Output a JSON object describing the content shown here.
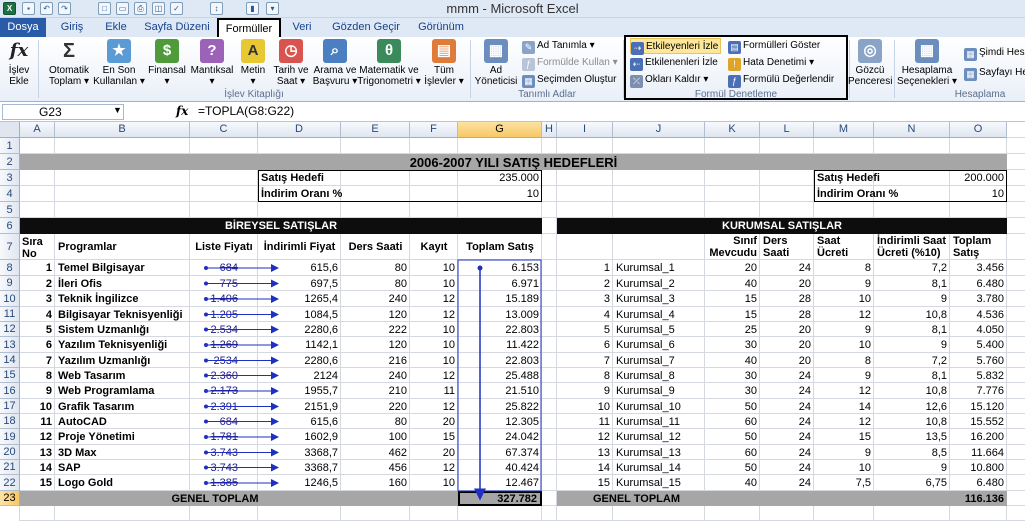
{
  "window": {
    "title": "mmm  -  Microsoft Excel",
    "app_icon": "excel-icon"
  },
  "quick_access": [
    "save-icon",
    "undo-icon",
    "redo-icon",
    "new-icon",
    "open-icon",
    "print-icon",
    "preview-icon",
    "spell-icon",
    "sort-icon",
    "chart-icon",
    "dropdown-icon"
  ],
  "tabs": [
    {
      "label": "Dosya",
      "state": "file"
    },
    {
      "label": "Giriş",
      "state": ""
    },
    {
      "label": "Ekle",
      "state": ""
    },
    {
      "label": "Sayfa Düzeni",
      "state": ""
    },
    {
      "label": "Formüller",
      "state": "active"
    },
    {
      "label": "Veri",
      "state": ""
    },
    {
      "label": "Gözden Geçir",
      "state": ""
    },
    {
      "label": "Görünüm",
      "state": ""
    }
  ],
  "ribbon": {
    "insert_function": {
      "line1": "İşlev",
      "line2": "Ekle"
    },
    "autosum": {
      "line1": "Otomatik",
      "line2": "Toplam ▾"
    },
    "recent": {
      "line1": "En Son",
      "line2": "Kullanılan ▾"
    },
    "financial": {
      "line1": "Finansal",
      "line2": "▾"
    },
    "logical": {
      "line1": "Mantıksal",
      "line2": "▾"
    },
    "text": {
      "line1": "Metin",
      "line2": "▾"
    },
    "datetime": {
      "line1": "Tarih ve",
      "line2": "Saat ▾"
    },
    "lookup": {
      "line1": "Arama ve",
      "line2": "Başvuru ▾"
    },
    "math": {
      "line1": "Matematik ve",
      "line2": "Trigonometri ▾"
    },
    "all_functions": {
      "line1": "Tüm",
      "line2": "İşlevler ▾"
    },
    "library_label": "İşlev Kitaplığı",
    "name_manager": {
      "line1": "Ad",
      "line2": "Yöneticisi"
    },
    "define_name": "Ad Tanımla ▾",
    "use_in_formula": "Formülde Kullan ▾",
    "create_from_selection": "Seçimden Oluştur",
    "names_label": "Tanımlı Adlar",
    "trace_precedents": "Etkileyenleri İzle",
    "trace_dependents": "Etkilenenleri İzle",
    "remove_arrows": "Okları Kaldır ▾",
    "show_formulas": "Formülleri Göster",
    "error_checking": "Hata Denetimi ▾",
    "evaluate_formula": "Formülü Değerlendir",
    "audit_label": "Formül Denetleme",
    "watch_window": {
      "line1": "Gözcü",
      "line2": "Penceresi"
    },
    "calc_options": {
      "line1": "Hesaplama",
      "line2": "Seçenekleri ▾"
    },
    "calc_now": "Şimdi Hesa",
    "calc_sheet": "Sayfayı He",
    "calc_label": "Hesaplama"
  },
  "formula_bar": {
    "name_box": "G23",
    "fx": "fx",
    "formula": "=TOPLA(G8:G22)"
  },
  "columns": [
    "A",
    "B",
    "C",
    "D",
    "E",
    "F",
    "G",
    "H",
    "I",
    "J",
    "K",
    "L",
    "M",
    "N",
    "O"
  ],
  "rows": [
    "1",
    "2",
    "3",
    "4",
    "5",
    "6",
    "7",
    "8",
    "9",
    "10",
    "11",
    "12",
    "13",
    "14",
    "15",
    "16",
    "17",
    "18",
    "19",
    "20",
    "21",
    "22",
    "23"
  ],
  "sheet": {
    "main_title": "2006-2007 YILI SATIŞ HEDEFLERİ",
    "left_target_label": "Satış Hedefi",
    "left_target_value": "235.000",
    "left_discount_label": "İndirim Oranı %",
    "left_discount_value": "10",
    "right_target_label": "Satış Hedefi",
    "right_target_value": "200.000",
    "right_discount_label": "İndirim Oranı %",
    "right_discount_value": "10",
    "left_section": "BİREYSEL SATIŞLAR",
    "right_section": "KURUMSAL SATIŞLAR",
    "left_headers": {
      "no": "Sıra No",
      "program": "Programlar",
      "list_price": "Liste Fiyatı",
      "disc_price": "İndirimli Fiyat",
      "hours": "Ders Saati",
      "reg": "Kayıt",
      "total": "Toplam Satış"
    },
    "right_headers": {
      "existing": "Sınıf Mevcudu",
      "hours": "Ders Saati",
      "fee": "Saat Ücreti",
      "disc_fee": "İndirimli Saat Ücreti (%10)",
      "total": "Toplam Satış"
    },
    "left_rows": [
      {
        "no": "1",
        "program": "Temel Bilgisayar",
        "list": "684",
        "disc": "615,6",
        "hours": "80",
        "reg": "10",
        "total": "6.153"
      },
      {
        "no": "2",
        "program": "İleri Ofis",
        "list": "775",
        "disc": "697,5",
        "hours": "80",
        "reg": "10",
        "total": "6.971"
      },
      {
        "no": "3",
        "program": "Teknik İngilizce",
        "list": "1.406",
        "disc": "1265,4",
        "hours": "240",
        "reg": "12",
        "total": "15.189"
      },
      {
        "no": "4",
        "program": "Bilgisayar Teknisyenliği",
        "list": "1.205",
        "disc": "1084,5",
        "hours": "120",
        "reg": "12",
        "total": "13.009"
      },
      {
        "no": "5",
        "program": "Sistem Uzmanlığı",
        "list": "2.534",
        "disc": "2280,6",
        "hours": "222",
        "reg": "10",
        "total": "22.803"
      },
      {
        "no": "6",
        "program": "Yazılım Teknisyenliği",
        "list": "1.269",
        "disc": "1142,1",
        "hours": "120",
        "reg": "10",
        "total": "11.422"
      },
      {
        "no": "7",
        "program": "Yazılım Uzmanlığı",
        "list": "2534",
        "disc": "2280,6",
        "hours": "216",
        "reg": "10",
        "total": "22.803"
      },
      {
        "no": "8",
        "program": "Web Tasarım",
        "list": "2.360",
        "disc": "2124",
        "hours": "240",
        "reg": "12",
        "total": "25.488"
      },
      {
        "no": "9",
        "program": "Web Programlama",
        "list": "2.173",
        "disc": "1955,7",
        "hours": "210",
        "reg": "11",
        "total": "21.510"
      },
      {
        "no": "10",
        "program": "Grafik Tasarım",
        "list": "2.391",
        "disc": "2151,9",
        "hours": "220",
        "reg": "12",
        "total": "25.822"
      },
      {
        "no": "11",
        "program": "AutoCAD",
        "list": "684",
        "disc": "615,6",
        "hours": "80",
        "reg": "20",
        "total": "12.305"
      },
      {
        "no": "12",
        "program": "Proje Yönetimi",
        "list": "1.781",
        "disc": "1602,9",
        "hours": "100",
        "reg": "15",
        "total": "24.042"
      },
      {
        "no": "13",
        "program": "3D Max",
        "list": "3.743",
        "disc": "3368,7",
        "hours": "462",
        "reg": "20",
        "total": "67.374"
      },
      {
        "no": "14",
        "program": "SAP",
        "list": "3.743",
        "disc": "3368,7",
        "hours": "456",
        "reg": "12",
        "total": "40.424"
      },
      {
        "no": "15",
        "program": "Logo Gold",
        "list": "1.385",
        "disc": "1246,5",
        "hours": "160",
        "reg": "10",
        "total": "12.467"
      }
    ],
    "right_rows": [
      {
        "no": "1",
        "name": "Kurumsal_1",
        "existing": "20",
        "hours": "24",
        "fee": "8",
        "disc": "7,2",
        "total": "3.456"
      },
      {
        "no": "2",
        "name": "Kurumsal_2",
        "existing": "40",
        "hours": "20",
        "fee": "9",
        "disc": "8,1",
        "total": "6.480"
      },
      {
        "no": "3",
        "name": "Kurumsal_3",
        "existing": "15",
        "hours": "28",
        "fee": "10",
        "disc": "9",
        "total": "3.780"
      },
      {
        "no": "4",
        "name": "Kurumsal_4",
        "existing": "15",
        "hours": "28",
        "fee": "12",
        "disc": "10,8",
        "total": "4.536"
      },
      {
        "no": "5",
        "name": "Kurumsal_5",
        "existing": "25",
        "hours": "20",
        "fee": "9",
        "disc": "8,1",
        "total": "4.050"
      },
      {
        "no": "6",
        "name": "Kurumsal_6",
        "existing": "30",
        "hours": "20",
        "fee": "10",
        "disc": "9",
        "total": "5.400"
      },
      {
        "no": "7",
        "name": "Kurumsal_7",
        "existing": "40",
        "hours": "20",
        "fee": "8",
        "disc": "7,2",
        "total": "5.760"
      },
      {
        "no": "8",
        "name": "Kurumsal_8",
        "existing": "30",
        "hours": "24",
        "fee": "9",
        "disc": "8,1",
        "total": "5.832"
      },
      {
        "no": "9",
        "name": "Kurumsal_9",
        "existing": "30",
        "hours": "24",
        "fee": "12",
        "disc": "10,8",
        "total": "7.776"
      },
      {
        "no": "10",
        "name": "Kurumsal_10",
        "existing": "50",
        "hours": "24",
        "fee": "14",
        "disc": "12,6",
        "total": "15.120"
      },
      {
        "no": "11",
        "name": "Kurumsal_11",
        "existing": "60",
        "hours": "24",
        "fee": "12",
        "disc": "10,8",
        "total": "15.552"
      },
      {
        "no": "12",
        "name": "Kurumsal_12",
        "existing": "50",
        "hours": "24",
        "fee": "15",
        "disc": "13,5",
        "total": "16.200"
      },
      {
        "no": "13",
        "name": "Kurumsal_13",
        "existing": "60",
        "hours": "24",
        "fee": "9",
        "disc": "8,5",
        "total": "11.664"
      },
      {
        "no": "14",
        "name": "Kurumsal_14",
        "existing": "50",
        "hours": "24",
        "fee": "10",
        "disc": "9",
        "total": "10.800"
      },
      {
        "no": "15",
        "name": "Kurumsal_15",
        "existing": "40",
        "hours": "24",
        "fee": "7,5",
        "disc": "6,75",
        "total": "6.480"
      }
    ],
    "left_total_label": "GENEL TOPLAM",
    "left_total_value": "327.782",
    "right_total_label": "GENEL TOPLAM",
    "right_total_value": "116.136"
  },
  "colors": {
    "accent": "#2a5ba8",
    "arrow": "#1f2fbf",
    "selected_header": "#f8c766"
  }
}
